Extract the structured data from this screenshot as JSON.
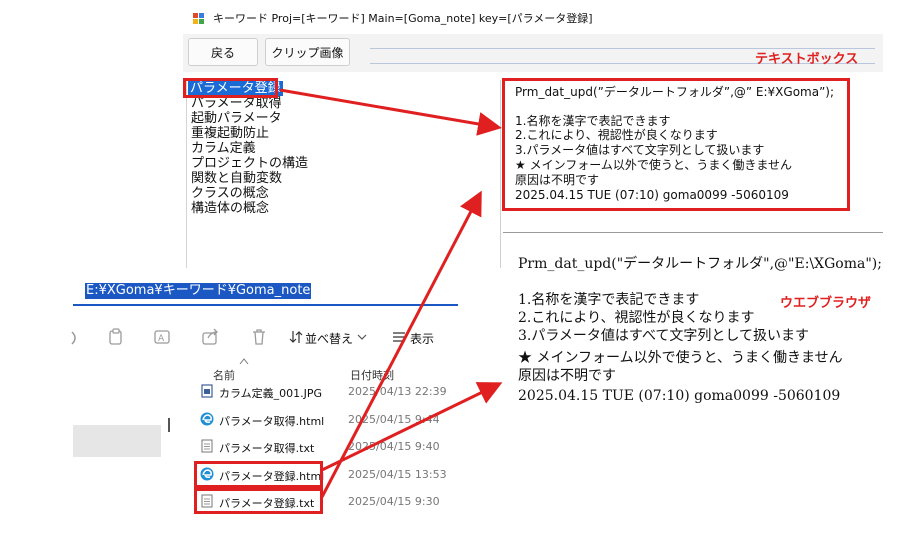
{
  "window": {
    "title": "キーワード  Proj=[キーワード]  Main=[Goma_note]  key=[パラメータ登録]"
  },
  "toolbar": {
    "back_label": "戻る",
    "clip_label": "クリップ画像",
    "textbox_label": "テキストボックス"
  },
  "list": {
    "items": [
      "パラメータ登録",
      "パラメータ取得",
      "起動パラメータ",
      "重複起動防止",
      "カラム定義",
      "プロジェクトの構造",
      "関数と自動変数",
      "クラスの概念",
      "構造体の概念"
    ]
  },
  "textbox": {
    "lines": [
      "Prm_dat_upd(”データルートフォルダ”,@” E:¥XGoma”);",
      "",
      "1.名称を漢字で表記できます",
      "2.これにより、視認性が良くなります",
      "3.パラメータ値はすべて文字列として扱います",
      "★  メインフォーム以外で使うと、うまく働きません",
      "原因は不明です",
      "2025.04.15 TUE (07:10) goma0099 -5060109"
    ]
  },
  "browser": {
    "label": "ウエブブラウザ",
    "lines": [
      "Prm_dat_upd(\"データルートフォルダ\",@\"E:\\XGoma\");",
      "",
      "1.名称を漢字で表記できます",
      "2.これにより、視認性が良くなります",
      "3.パラメータ値はすべて文字列として扱います",
      "★  メインフォーム以外で使うと、うまく働きません",
      "原因は不明です",
      "2025.04.15 TUE (07:10) goma0099 -5060109"
    ]
  },
  "explorer": {
    "address": "E:¥XGoma¥キーワード¥Goma_note",
    "sort_label": "並べ替え",
    "view_label": "表示",
    "col_name": "名前",
    "col_date": "日付時刻",
    "files": [
      {
        "name": "カラム定義_001.JPG",
        "date": "2025/04/13 22:39",
        "icon": "image-file-icon"
      },
      {
        "name": "パラメータ取得.html",
        "date": "2025/04/15 9:44",
        "icon": "edge-html-icon"
      },
      {
        "name": "パラメータ取得.txt",
        "date": "2025/04/15 9:40",
        "icon": "text-file-icon"
      },
      {
        "name": "パラメータ登録.html",
        "date": "2025/04/15 13:53",
        "icon": "edge-html-icon"
      },
      {
        "name": "パラメータ登録.txt",
        "date": "2025/04/15 9:30",
        "icon": "text-file-icon"
      }
    ]
  },
  "colors": {
    "annotation_red": "#e02020",
    "selection_blue": "#1a6bd6"
  }
}
